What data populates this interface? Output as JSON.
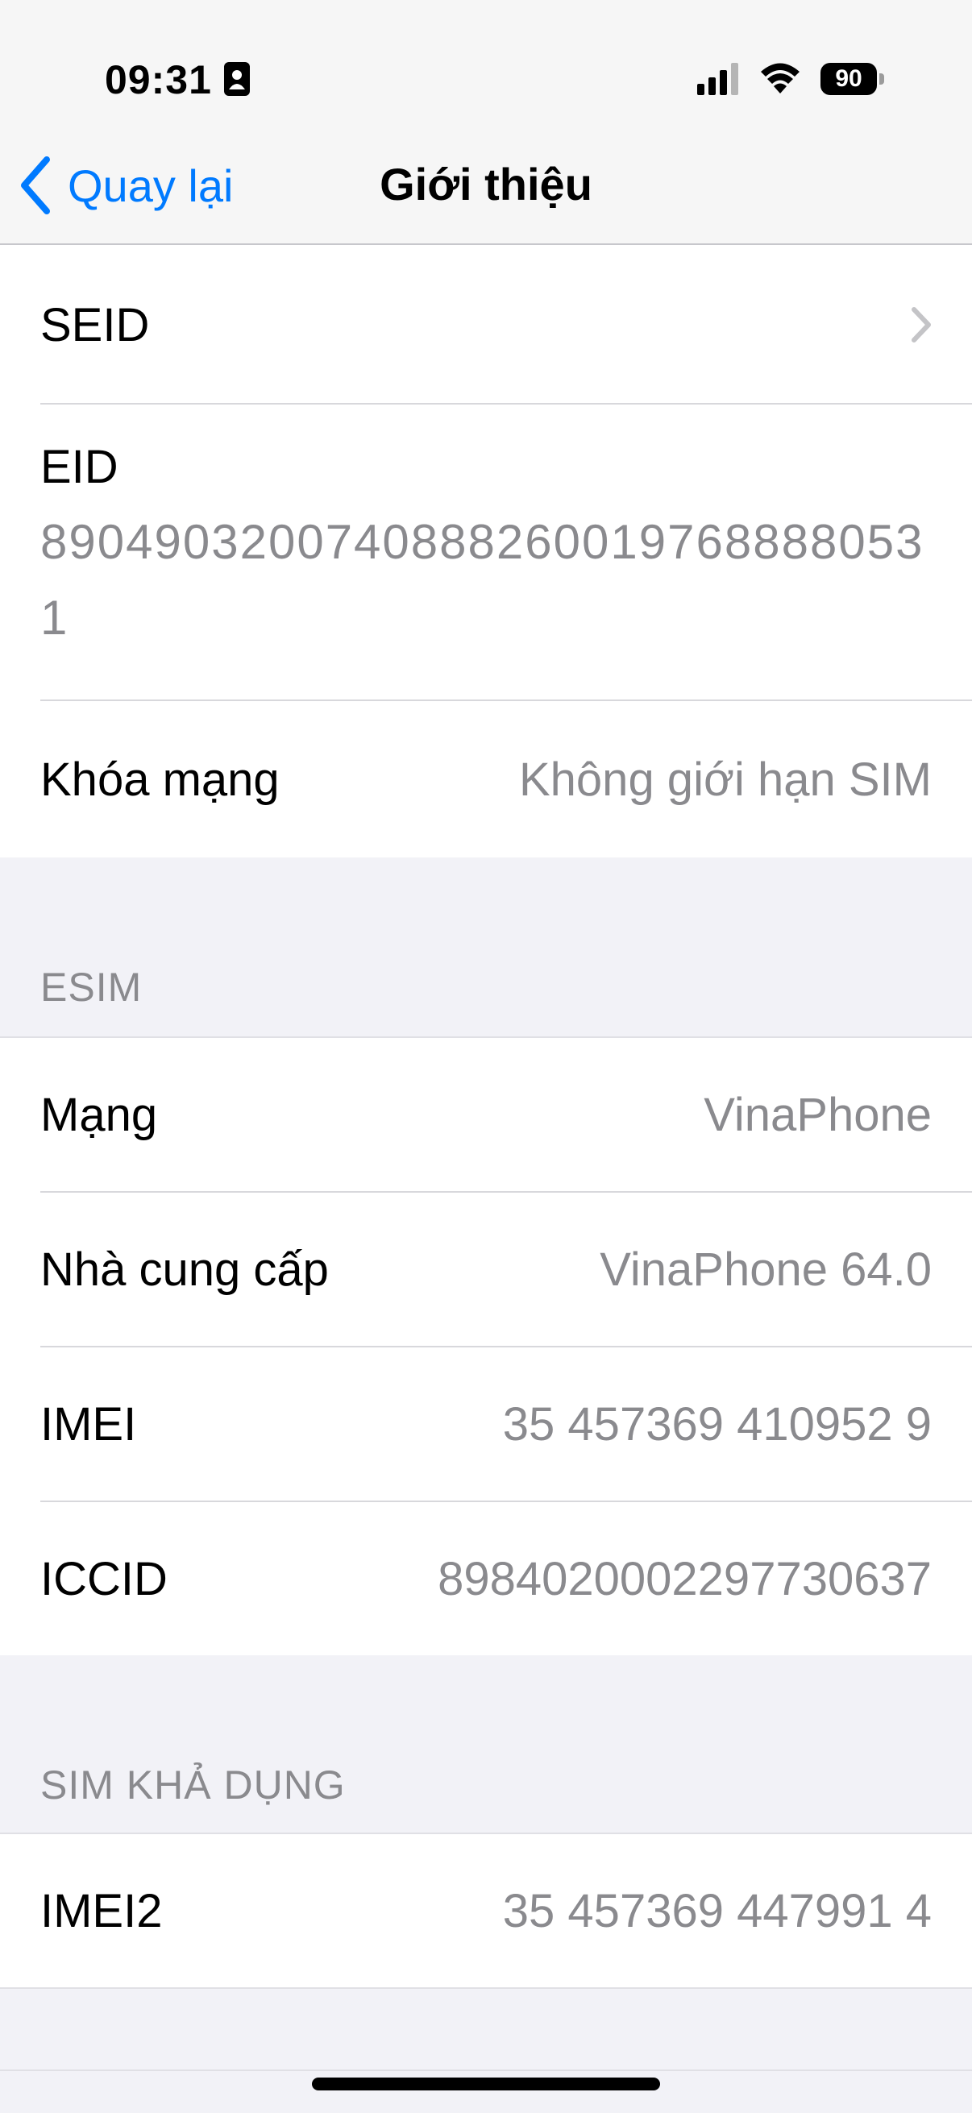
{
  "status_bar": {
    "time": "09:31",
    "battery": "90"
  },
  "nav": {
    "back_label": "Quay lại",
    "title": "Giới thiệu"
  },
  "group1": {
    "seid_label": "SEID",
    "eid_label": "EID",
    "eid_value": "89049032007408882600197688880531",
    "network_lock_label": "Khóa mạng",
    "network_lock_value": "Không giới hạn SIM"
  },
  "esim": {
    "header": "ESIM",
    "rows": [
      {
        "label": "Mạng",
        "value": "VinaPhone"
      },
      {
        "label": "Nhà cung cấp",
        "value": "VinaPhone 64.0"
      },
      {
        "label": "IMEI",
        "value": "35 457369 410952 9"
      },
      {
        "label": "ICCID",
        "value": "8984020002297730637"
      }
    ]
  },
  "sim_available": {
    "header": "SIM KHẢ DỤNG",
    "rows": [
      {
        "label": "IMEI2",
        "value": "35 457369 447991 4"
      }
    ]
  },
  "colors": {
    "accent": "#007aff",
    "secondary_text": "#8a8a8e",
    "background": "#f2f2f7"
  }
}
